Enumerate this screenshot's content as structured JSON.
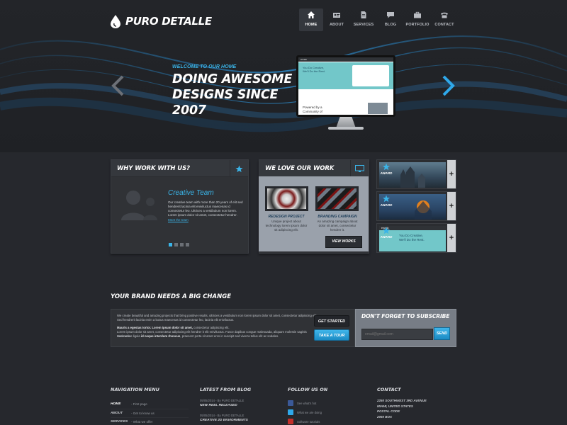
{
  "brand": {
    "name": "PURO DETALLE"
  },
  "nav": {
    "items": [
      {
        "label": "HOME",
        "icon": "home-icon",
        "active": true
      },
      {
        "label": "ABOUT",
        "icon": "id-card-icon",
        "active": false
      },
      {
        "label": "SERVICES",
        "icon": "document-icon",
        "active": false
      },
      {
        "label": "BLOG",
        "icon": "chat-bubble-icon",
        "active": false
      },
      {
        "label": "PORTFOLIO",
        "icon": "briefcase-icon",
        "active": false
      },
      {
        "label": "CONTACT",
        "icon": "phone-icon",
        "active": false
      }
    ]
  },
  "hero": {
    "subtitle": "WELCOME TO OUR HOME",
    "title_line1": "DOING AWESOME",
    "title_line2": "DESIGNS SINCE 2007",
    "screen": {
      "brand": "envato",
      "tagline_1": "You Do Creative,",
      "tagline_2": "We'll Do the Rest.",
      "powered_1": "Powered by a",
      "powered_2": "Community of"
    },
    "accent": "#3ab4e8"
  },
  "why": {
    "title": "WHY WORK WITH US?",
    "team_title": "Creative Team",
    "team_text": "Our creative team with more than 20 years of elit sed hendrerit lacinia elit eniviluctus maecenas id consectetur leo. Ultrices a vestibulum non lorem. Lorem ipsum dolor sit amet, consectetur hendrer.",
    "team_link": "Meet the team"
  },
  "work": {
    "title": "WE LOVE OUR WORK",
    "items": [
      {
        "title": "REDESIGN PROJECT",
        "text": "Unique project about technology lorem ipsum dolor sit adipiscing elit."
      },
      {
        "title": "BRANDING CAMPAIGN",
        "text": "An amazing campaign about dolor sit amet, consectetur hendrer it."
      }
    ],
    "button": "VIEW WORKS"
  },
  "awards": [
    {
      "badge": "AWARD"
    },
    {
      "badge": "AWARD"
    },
    {
      "badge": "AWARD",
      "brand": "envato",
      "line1": "You Do Creative,",
      "line2": "We'll Do the Rest."
    }
  ],
  "brand_section": {
    "title": "YOUR BRAND NEEDS A BIG CHANGE",
    "p1": "We create beautiful and amazing projects that bring positive results, ultricies a vestibulum non lorem ipsum dolor sit amet, consectetur adipiscing elit. Sed hendrerit lacinia enim a luctus maecenas id consectetur leo, lacinia elit eniviluctus.",
    "p2_bold": "Mauris a egestas tortor. Lorem ipsum dolor sit amet,",
    "p2_rest": " consectetur adipiscing elit.",
    "p3": "Lorem ipsum dolor sit amet, consectetur adipiscing elit hendrer it elit eniviluctus. Fusce dapibus congue malesuada, aliquam molestie sagittis commodo.",
    "p4_start": "Sed cursus ligula ",
    "p4_bold": "id neque interdum rhoncus",
    "p4_end": ", praesent porta sit amet eros in suscipit sed viverra tellus elit ac sodales.",
    "get_started": "GET STARTED",
    "take_tour": "TAKE A TOUR"
  },
  "subscribe": {
    "title": "DON'T FORGET TO SUBSCRIBE",
    "placeholder": "email@gmail.com",
    "button": "SEND"
  },
  "footer": {
    "nav_title": "NAVIGATION MENU",
    "nav_rows": [
      {
        "label": "HOME",
        "desc": "- First page"
      },
      {
        "label": "ABOUT",
        "desc": "- Get to know us"
      },
      {
        "label": "SERVICES",
        "desc": "- What we offer"
      }
    ],
    "blog_title": "LATEST FROM BLOG",
    "blog": [
      {
        "date": "05/05/2014 - By PURO DETALLE",
        "title": "NEW REEL RELEASED"
      },
      {
        "date": "05/05/2014 - By PURO DETALLE",
        "title": "CREATIVE 2D ENVIORMENTS"
      }
    ],
    "follow_title": "FOLLOW US ON",
    "follow": [
      {
        "icon": "facebook-icon",
        "text": "See what's hot"
      },
      {
        "icon": "twitter-icon",
        "text": "What we are doing"
      },
      {
        "icon": "youtube-icon",
        "text": "Software tutorials"
      }
    ],
    "contact_title": "CONTACT",
    "contact_lines": [
      "2250 SOUTHWEST 3RD AVENUE",
      "MIAMI, UNITED STATES",
      "POSTAL CODE",
      "2050 BOX"
    ]
  }
}
